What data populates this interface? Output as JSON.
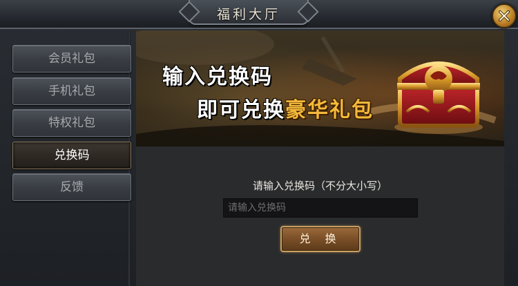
{
  "window": {
    "title": "福利大厅"
  },
  "sidebar": {
    "items": [
      {
        "label": "会员礼包"
      },
      {
        "label": "手机礼包"
      },
      {
        "label": "特权礼包"
      },
      {
        "label": "兑换码",
        "active": true
      },
      {
        "label": "反馈"
      }
    ]
  },
  "banner": {
    "line1": "输入兑换码",
    "line2_prefix": "即可兑换",
    "line2_highlight": "豪华礼包"
  },
  "redeem": {
    "prompt": "请输入兑换码（不分大小写）",
    "input_placeholder": "请输入兑换码",
    "input_value": "",
    "button_label": "兑 换"
  },
  "icons": {
    "close": "close-icon",
    "banner_image": "treasure-chest-icon"
  },
  "colors": {
    "accent_gold": "#f4b93a",
    "button_brown": "#7a4f27",
    "active_tab_text": "#ffffff",
    "inactive_tab_text": "#a7a9ac"
  }
}
